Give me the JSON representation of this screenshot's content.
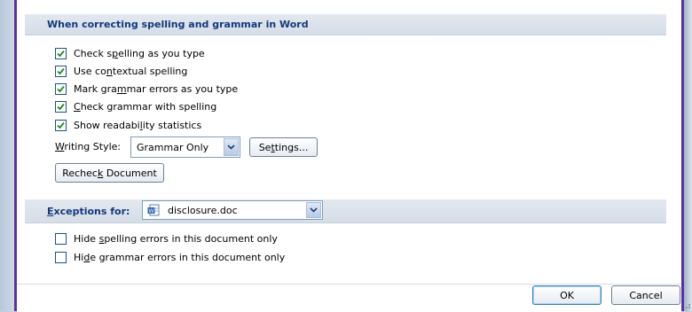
{
  "section_spelling": {
    "title": "When correcting spelling and grammar in Word"
  },
  "options": [
    {
      "pre": "Check s",
      "ul": "p",
      "post": "elling as you type",
      "checked": true
    },
    {
      "pre": "Use co",
      "ul": "n",
      "post": "textual spelling",
      "checked": true
    },
    {
      "pre": "Mark gra",
      "ul": "m",
      "post": "mar errors as you type",
      "checked": true
    },
    {
      "pre": "",
      "ul": "C",
      "post": "heck grammar with spelling",
      "checked": true
    },
    {
      "pre": "Show readabi",
      "ul": "l",
      "post": "ity statistics",
      "checked": true
    }
  ],
  "writing_style": {
    "label_ul": "W",
    "label_rest": "riting Style:",
    "value": "Grammar Only"
  },
  "settings_button": {
    "pre": "Se",
    "ul": "t",
    "post": "tings..."
  },
  "recheck_button": {
    "pre": "Rechec",
    "ul": "k",
    "post": " Document"
  },
  "section_exceptions": {
    "label_ul": "E",
    "label_rest": "xceptions for:",
    "document": "disclosure.doc"
  },
  "exceptions_options": [
    {
      "pre": "Hide ",
      "ul": "s",
      "post": "pelling errors in this document only",
      "checked": false
    },
    {
      "pre": "Hi",
      "ul": "d",
      "post": "e grammar errors in this document only",
      "checked": false
    }
  ],
  "footer": {
    "ok_label": "OK",
    "cancel_label": "Cancel"
  },
  "colors": {
    "accent_border": "#5a32a0",
    "header_text": "#14387a",
    "check_green": "#1e8a1e"
  },
  "icons": [
    "checkmark-icon",
    "chevron-down-icon",
    "word-document-icon",
    "resize-grip-icon"
  ]
}
